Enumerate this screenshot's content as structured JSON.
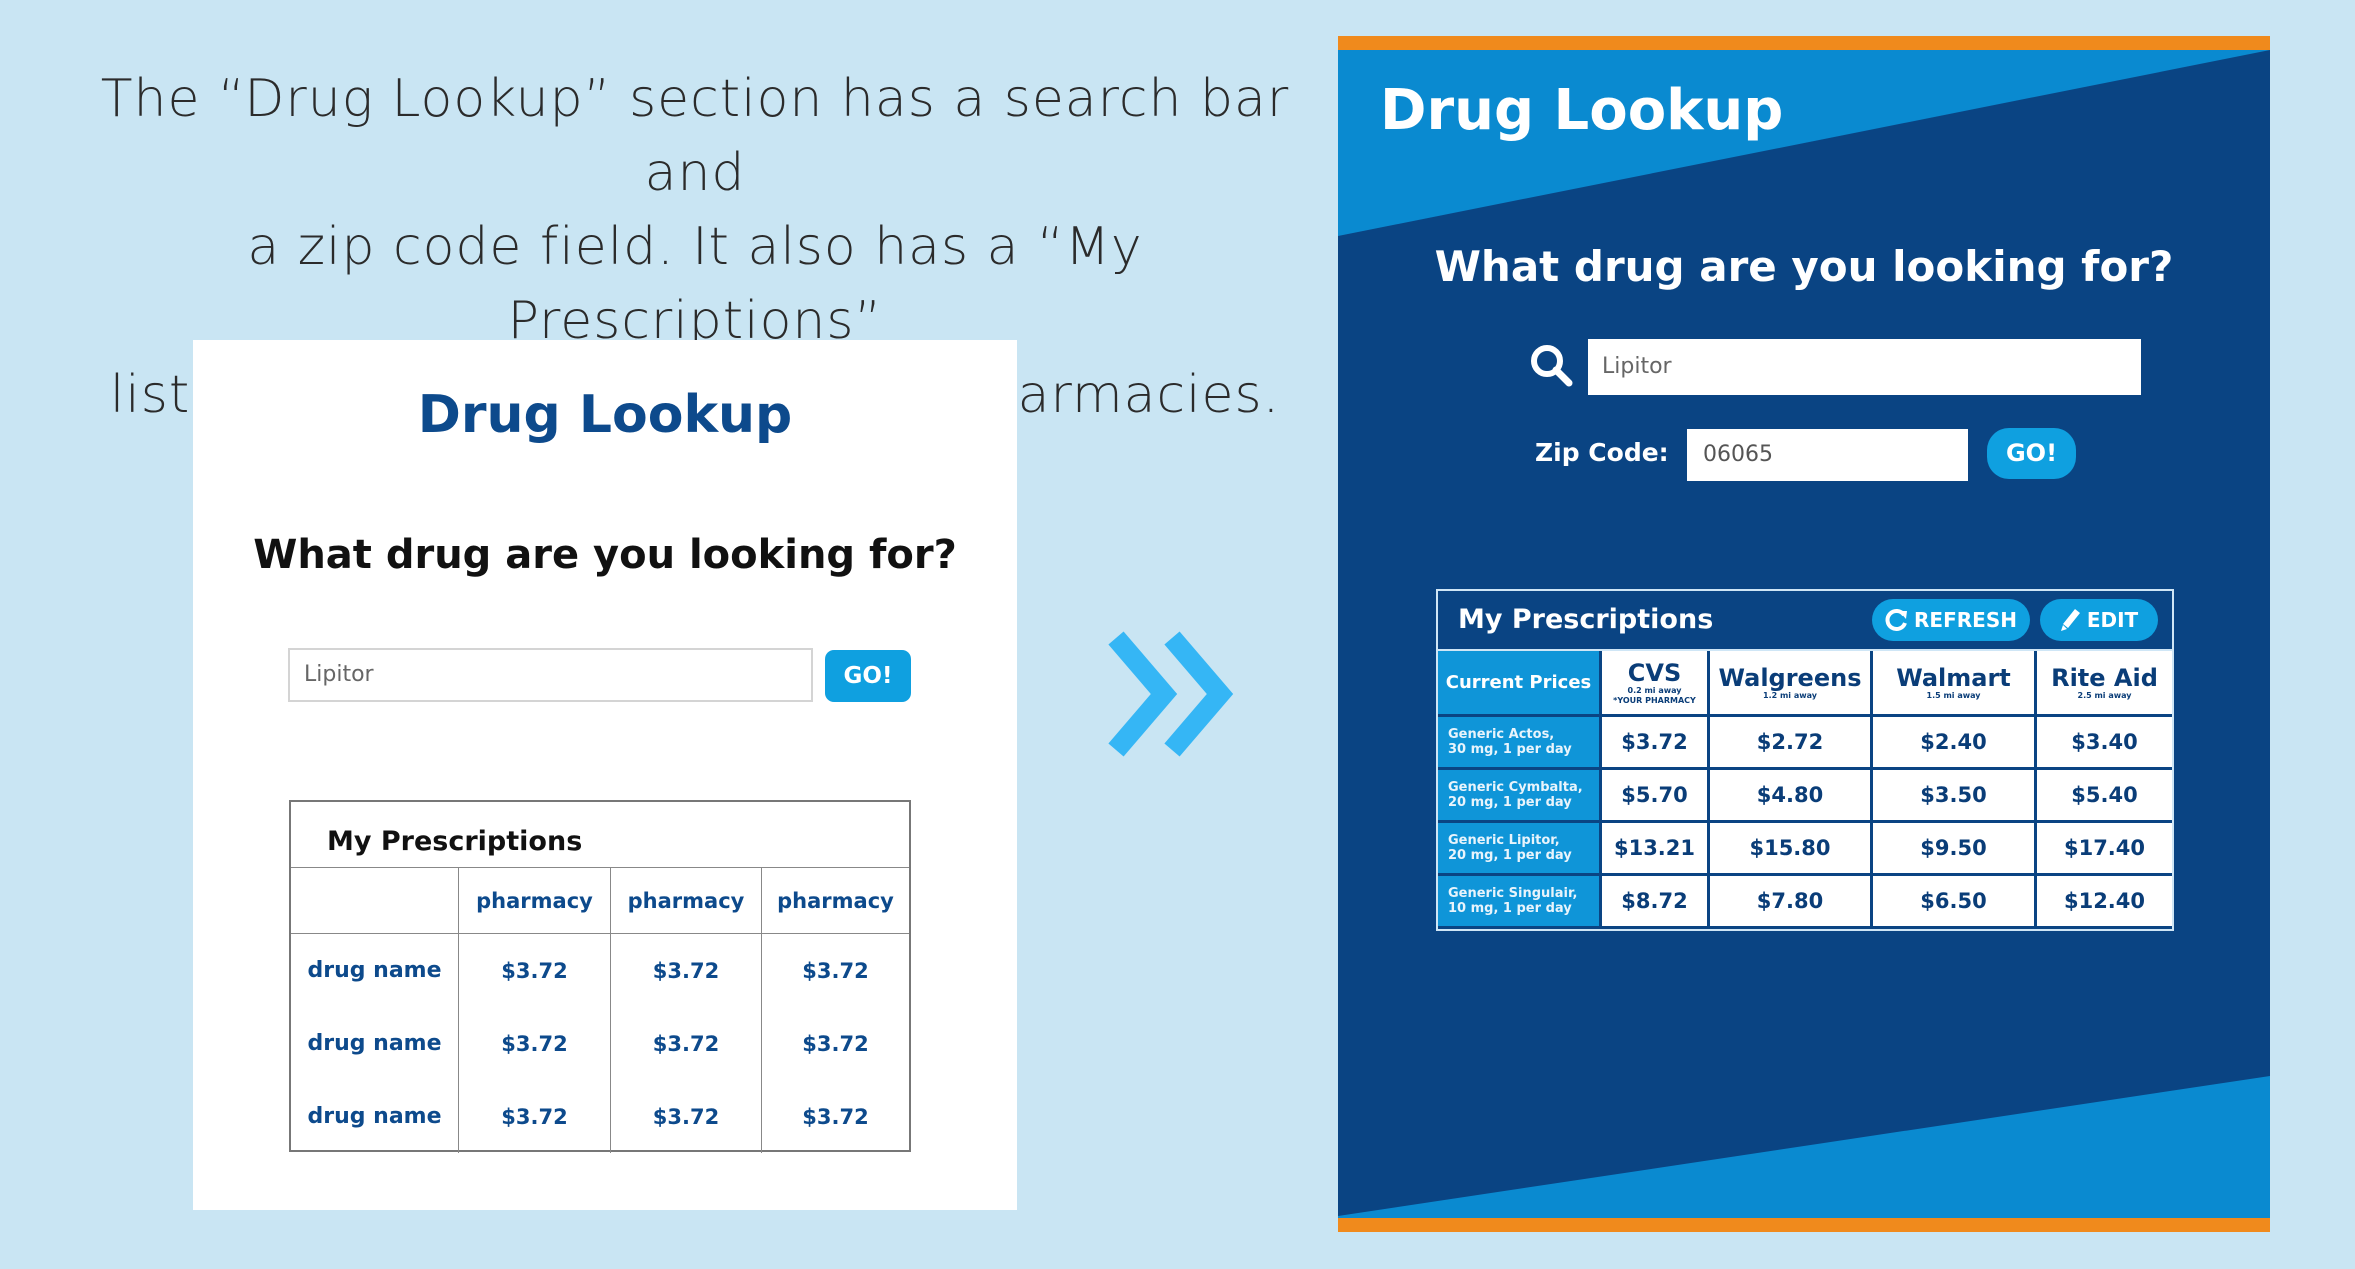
{
  "caption": {
    "line1": "The “Drug Lookup” section has a search bar and",
    "line2": "a zip code field. It also has a “My Prescriptions”",
    "line3": "list with live prices at selected pharmacies."
  },
  "wireframe": {
    "title": "Drug Lookup",
    "question": "What drug are you looking for?",
    "search_value": "Lipitor",
    "go_label": "GO!",
    "table_title": "My Prescriptions",
    "headers": [
      "",
      "pharmacy",
      "pharmacy",
      "pharmacy"
    ],
    "rows": [
      {
        "name": "drug name",
        "prices": [
          "$3.72",
          "$3.72",
          "$3.72"
        ]
      },
      {
        "name": "drug name",
        "prices": [
          "$3.72",
          "$3.72",
          "$3.72"
        ]
      },
      {
        "name": "drug name",
        "prices": [
          "$3.72",
          "$3.72",
          "$3.72"
        ]
      }
    ]
  },
  "mockup": {
    "title": "Drug Lookup",
    "question": "What drug are you looking for?",
    "search_icon": "search-icon",
    "search_value": "Lipitor",
    "zip_label": "Zip Code:",
    "zip_value": "06065",
    "go_label": "GO!",
    "prescriptions": {
      "title": "My Prescriptions",
      "refresh_label": "REFRESH",
      "refresh_icon": "refresh-icon",
      "edit_label": "EDIT",
      "edit_icon": "pencil-icon",
      "current_prices_label": "Current Prices",
      "pharmacies": [
        {
          "name": "CVS",
          "distance": "0.2 mi away",
          "note": "*YOUR PHARMACY"
        },
        {
          "name": "Walgreens",
          "distance": "1.2 mi away",
          "note": ""
        },
        {
          "name": "Walmart",
          "distance": "1.5 mi away",
          "note": ""
        },
        {
          "name": "Rite Aid",
          "distance": "2.5 mi away",
          "note": ""
        }
      ],
      "drugs": [
        {
          "line1": "Generic Actos,",
          "line2": "30 mg, 1 per day",
          "prices": [
            "$3.72",
            "$2.72",
            "$2.40",
            "$3.40"
          ]
        },
        {
          "line1": "Generic Cymbalta,",
          "line2": "20 mg, 1 per day",
          "prices": [
            "$5.70",
            "$4.80",
            "$3.50",
            "$5.40"
          ]
        },
        {
          "line1": "Generic Lipitor,",
          "line2": "20 mg, 1 per day",
          "prices": [
            "$13.21",
            "$15.80",
            "$9.50",
            "$17.40"
          ]
        },
        {
          "line1": "Generic Singulair,",
          "line2": "10 mg, 1 per day",
          "prices": [
            "$8.72",
            "$7.80",
            "$6.50",
            "$12.40"
          ]
        }
      ]
    }
  },
  "colors": {
    "page_bg": "#c9e5f3",
    "navy": "#0a4483",
    "accent_blue": "#0fa0e0",
    "orange": "#f08a1c"
  }
}
